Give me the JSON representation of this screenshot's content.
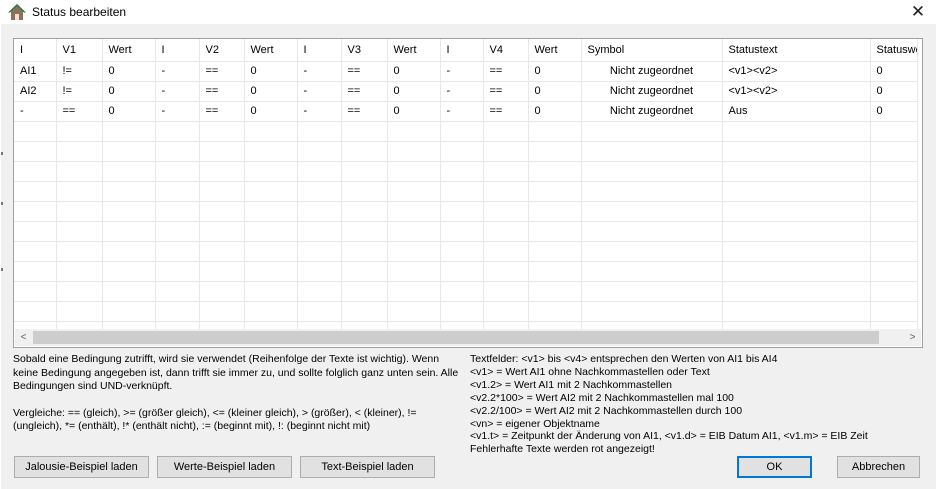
{
  "window": {
    "title": "Status bearbeiten",
    "close_glyph": "✕"
  },
  "grid": {
    "columns": [
      "I",
      "V1",
      "Wert",
      "I",
      "V2",
      "Wert",
      "I",
      "V3",
      "Wert",
      "I",
      "V4",
      "Wert",
      "Symbol",
      "Statustext",
      "Statuswe"
    ],
    "rows": [
      [
        "AI1",
        "!=",
        "0",
        "-",
        "==",
        "0",
        "-",
        "==",
        "0",
        "-",
        "==",
        "0",
        "Nicht zugeordnet",
        "<v1><v2>",
        "0"
      ],
      [
        "AI2",
        "!=",
        "0",
        "-",
        "==",
        "0",
        "-",
        "==",
        "0",
        "-",
        "==",
        "0",
        "Nicht zugeordnet",
        "<v1><v2>",
        "0"
      ],
      [
        "-",
        "==",
        "0",
        "-",
        "==",
        "0",
        "-",
        "==",
        "0",
        "-",
        "==",
        "0",
        "Nicht zugeordnet",
        "Aus",
        "0"
      ]
    ],
    "empty_rows": 11,
    "scroll_left_glyph": "<",
    "scroll_right_glyph": ">"
  },
  "info": {
    "rule_text": "Sobald eine Bedingung zutrifft, wird sie verwendet (Reihenfolge der Texte ist wichtig). Wenn keine Bedingung angegeben ist, dann trifft sie immer zu, und sollte folglich ganz unten sein. Alle Bedingungen sind UND-verknüpft.",
    "compare_text": "Vergleiche: == (gleich), >= (größer gleich), <= (kleiner gleich), > (größer), < (kleiner), != (ungleich), *= (enthält), !* (enthält nicht), := (beginnt mit), !: (beginnt nicht mit)",
    "textfields": [
      "Textfelder: <v1> bis <v4> entsprechen den Werten von AI1 bis AI4",
      "<v1> = Wert AI1 ohne Nachkommastellen oder Text",
      "<v1.2> = Wert AI1 mit 2 Nachkommastellen",
      "<v2.2*100> = Wert AI2 mit 2 Nachkommastellen mal 100",
      "<v2.2/100> = Wert AI2 mit 2 Nachkommastellen durch 100",
      "<vn> = eigener Objektname",
      "<v1.t> = Zeitpunkt der Änderung von AI1, <v1.d> = EIB Datum AI1, <v1.m> = EIB Zeit",
      "Fehlerhafte Texte werden rot angezeigt!"
    ]
  },
  "buttons": {
    "jalousie": "Jalousie-Beispiel laden",
    "werte": "Werte-Beispiel laden",
    "text": "Text-Beispiel laden",
    "ok": "OK",
    "cancel": "Abbrechen"
  },
  "colors": {
    "accent": "#0078d7",
    "icon_roof": "#2e7d32",
    "icon_house": "#8d6e63"
  }
}
